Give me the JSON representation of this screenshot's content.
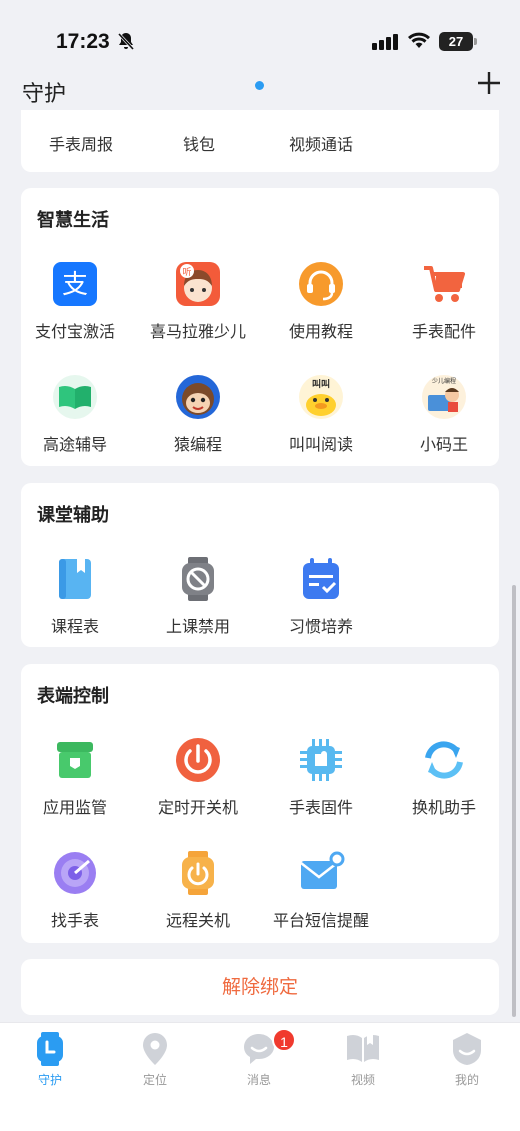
{
  "status_bar": {
    "time": "17:23",
    "battery": "27"
  },
  "nav": {
    "title": "守护"
  },
  "top_card": {
    "items": [
      {
        "label": "手表周报"
      },
      {
        "label": "钱包"
      },
      {
        "label": "视频通话"
      }
    ]
  },
  "smart_life": {
    "title": "智慧生活",
    "items": [
      {
        "label": "支付宝激活",
        "icon": "alipay-icon"
      },
      {
        "label": "喜马拉雅少儿",
        "icon": "ximalaya-kids-icon",
        "icon_text": "听"
      },
      {
        "label": "使用教程",
        "icon": "tutorial-headset-icon"
      },
      {
        "label": "手表配件",
        "icon": "shopping-cart-icon"
      },
      {
        "label": "高途辅导",
        "icon": "gaotu-book-icon"
      },
      {
        "label": "猿编程",
        "icon": "yuan-monkey-icon"
      },
      {
        "label": "叫叫阅读",
        "icon": "jiaojiao-duck-icon",
        "icon_text": "叫叫"
      },
      {
        "label": "小码王",
        "icon": "xiaomawang-icon",
        "icon_text": "少儿编程"
      }
    ]
  },
  "classroom": {
    "title": "课堂辅助",
    "items": [
      {
        "label": "课程表",
        "icon": "schedule-book-icon"
      },
      {
        "label": "上课禁用",
        "icon": "class-disable-icon"
      },
      {
        "label": "习惯培养",
        "icon": "habit-calendar-icon"
      }
    ]
  },
  "watch_control": {
    "title": "表端控制",
    "items": [
      {
        "label": "应用监管",
        "icon": "app-box-icon"
      },
      {
        "label": "定时开关机",
        "icon": "power-timer-icon"
      },
      {
        "label": "手表固件",
        "icon": "chip-icon"
      },
      {
        "label": "换机助手",
        "icon": "swap-arrows-icon"
      },
      {
        "label": "找手表",
        "icon": "find-watch-icon"
      },
      {
        "label": "远程关机",
        "icon": "remote-power-icon"
      },
      {
        "label": "平台短信提醒",
        "icon": "sms-envelope-icon"
      }
    ]
  },
  "unbind": {
    "label": "解除绑定"
  },
  "tab_bar": {
    "tabs": [
      {
        "label": "守护",
        "active": true
      },
      {
        "label": "定位"
      },
      {
        "label": "消息",
        "badge": "1"
      },
      {
        "label": "视频"
      },
      {
        "label": "我的"
      }
    ]
  },
  "colors": {
    "accent": "#2b9cf2",
    "danger": "#ef6a3f",
    "badge": "#f03a2e"
  }
}
